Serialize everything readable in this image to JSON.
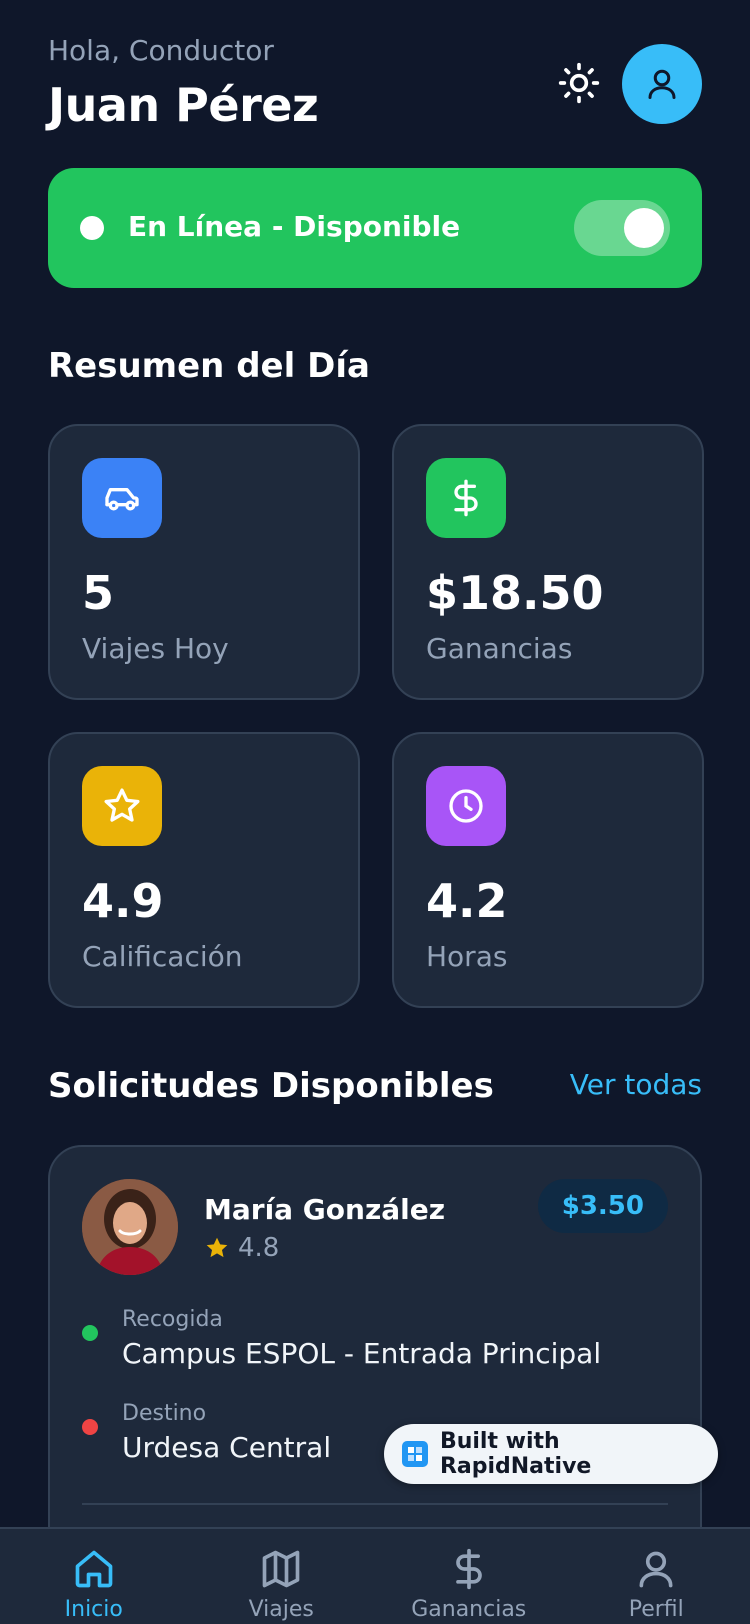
{
  "header": {
    "greeting": "Hola, Conductor",
    "name": "Juan Pérez",
    "theme_icon": "sun-icon",
    "avatar_icon": "user-icon"
  },
  "status": {
    "label": "En Línea - Disponible",
    "online": true
  },
  "summary": {
    "title": "Resumen del Día",
    "cards": [
      {
        "icon": "car-icon",
        "color": "#3b82f6",
        "value": "5",
        "label": "Viajes Hoy"
      },
      {
        "icon": "dollar-icon",
        "color": "#22c55e",
        "value": "$18.50",
        "label": "Ganancias"
      },
      {
        "icon": "star-icon",
        "color": "#eab308",
        "value": "4.9",
        "label": "Calificación"
      },
      {
        "icon": "clock-icon",
        "color": "#a855f7",
        "value": "4.2",
        "label": "Horas"
      }
    ]
  },
  "requests": {
    "title": "Solicitudes Disponibles",
    "see_all": "Ver todas",
    "items": [
      {
        "passenger": "María González",
        "rating": "4.8",
        "fare": "$3.50",
        "pickup_label": "Recogida",
        "pickup": "Campus ESPOL - Entrada Principal",
        "destination_label": "Destino",
        "destination": "Urdesa Central"
      }
    ]
  },
  "badge": {
    "text": "Built with RapidNative"
  },
  "nav": {
    "items": [
      {
        "label": "Inicio",
        "icon": "home-icon",
        "active": true
      },
      {
        "label": "Viajes",
        "icon": "map-icon",
        "active": false
      },
      {
        "label": "Ganancias",
        "icon": "dollar-icon",
        "active": false
      },
      {
        "label": "Perfil",
        "icon": "user-icon",
        "active": false
      }
    ]
  },
  "colors": {
    "background": "#0f172a",
    "card": "#1e293b",
    "accent": "#38bdf8",
    "online": "#22c55e",
    "pickup_dot": "#22c55e",
    "destination_dot": "#ef4444"
  }
}
